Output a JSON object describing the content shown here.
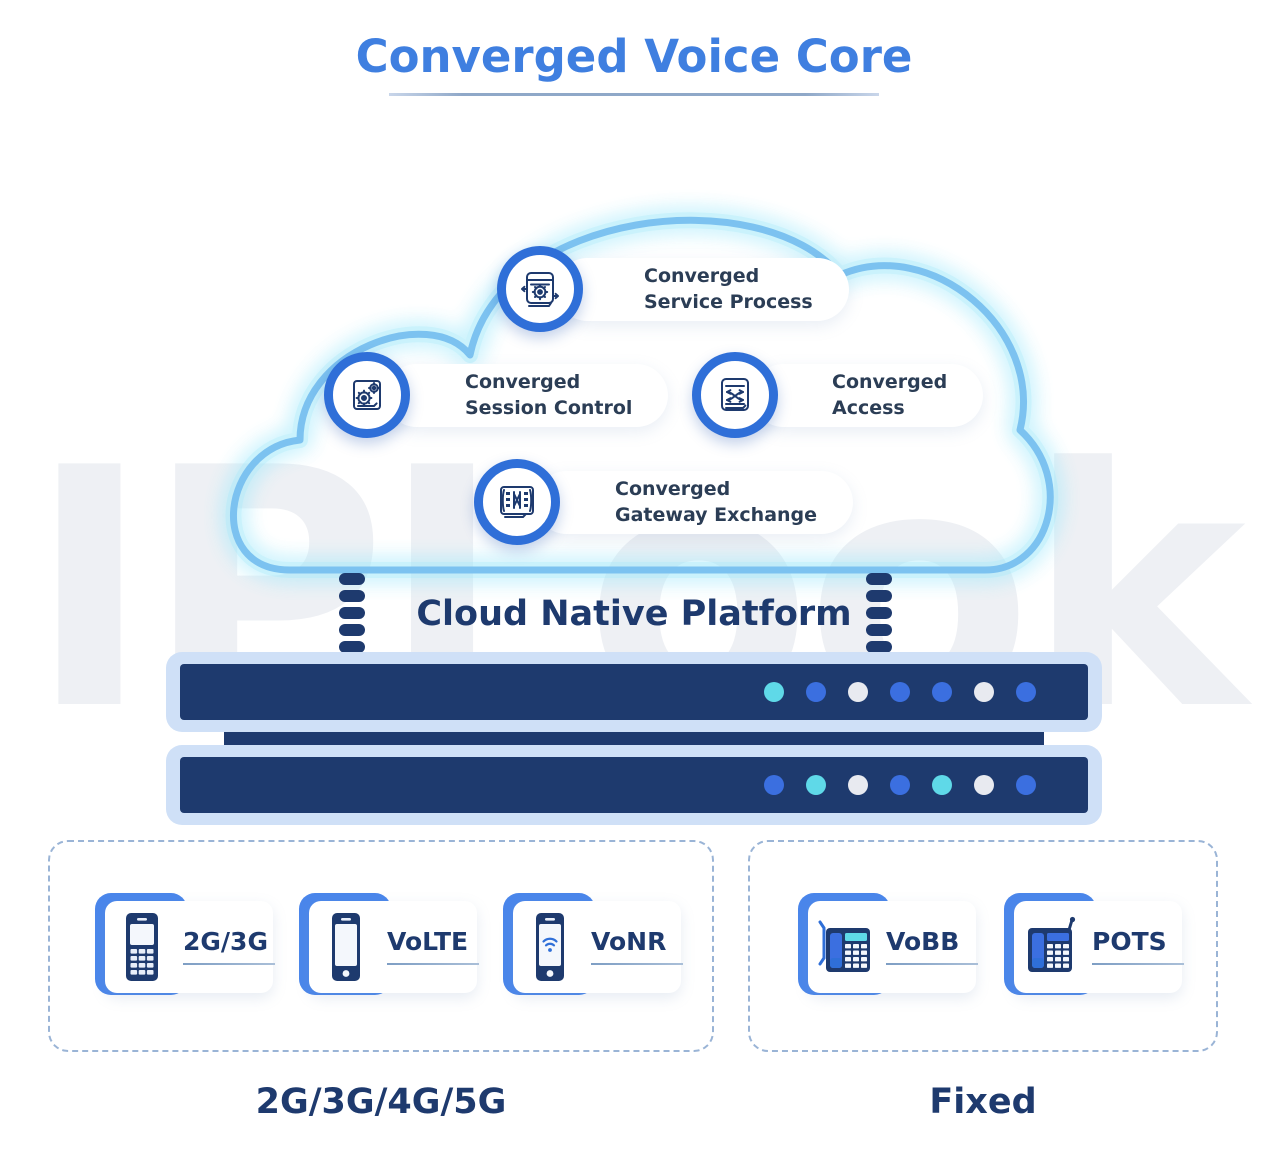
{
  "header": {
    "title": "Converged Voice Core"
  },
  "watermark": {
    "text": "IPLook"
  },
  "cloud": {
    "stroke_color": "#7cc2f0",
    "glow_color": "#9fe8fb",
    "items": [
      {
        "id": "converged-service-process",
        "icon": "service-process-icon",
        "line1": "Converged",
        "line2": "Service Process"
      },
      {
        "id": "converged-session-control",
        "icon": "session-control-icon",
        "line1": "Converged",
        "line2": "Session Control"
      },
      {
        "id": "converged-access",
        "icon": "converged-access-icon",
        "line1": "Converged",
        "line2": "Access"
      },
      {
        "id": "converged-gateway-exchange",
        "icon": "gateway-exchange-icon",
        "line1": "Converged",
        "line2": "Gateway Exchange"
      }
    ]
  },
  "platform": {
    "label": "Cloud Native Platform",
    "chassis_color": "#1e3a6e",
    "frame_color": "#cfe0f7",
    "servers": [
      {
        "id": "server-top",
        "leds": [
          "#5fd9e8",
          "#3b6fe0",
          "#e8eaf0",
          "#3b6fe0",
          "#3b6fe0",
          "#e8eaf0",
          "#3b6fe0"
        ]
      },
      {
        "id": "server-bottom",
        "leds": [
          "#3b6fe0",
          "#5fd9e8",
          "#e8eaf0",
          "#3b6fe0",
          "#5fd9e8",
          "#e8eaf0",
          "#3b6fe0"
        ]
      }
    ]
  },
  "access_groups": [
    {
      "id": "mobile",
      "title": "2G/3G/4G/5G",
      "devices": [
        {
          "id": "2g3g",
          "label": "2G/3G",
          "icon": "feature-phone-icon"
        },
        {
          "id": "volte",
          "label": "VoLTE",
          "icon": "smartphone-icon"
        },
        {
          "id": "vonr",
          "label": "VoNR",
          "icon": "smartphone-wifi-icon"
        }
      ]
    },
    {
      "id": "fixed",
      "title": "Fixed",
      "devices": [
        {
          "id": "vobb",
          "label": "VoBB",
          "icon": "desk-phone-display-icon"
        },
        {
          "id": "pots",
          "label": "POTS",
          "icon": "desk-phone-icon"
        }
      ]
    }
  ],
  "colors": {
    "title_blue": "#3f7fe0",
    "navy": "#1e3a6e",
    "accent_blue": "#2f6fd8",
    "device_blue": "#4a86eb",
    "cyan": "#5fd9e8",
    "dashed_border": "#9ab4d6"
  }
}
